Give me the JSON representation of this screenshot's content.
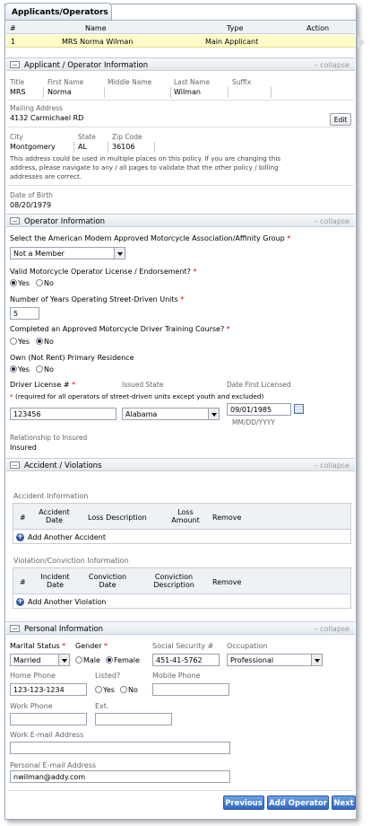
{
  "tab_title": "Applicants/Operators",
  "grid": {
    "headers": [
      "#",
      "Name",
      "Type",
      "Action"
    ],
    "row": {
      "num": "1",
      "name": "MRS Norma Wilman",
      "type": "Main Applicant"
    }
  },
  "collapse_label": "– collapse",
  "applicant": {
    "title": "Applicant / Operator Information",
    "labels": {
      "title": "Title",
      "first": "First Name",
      "middle": "Middle Name",
      "last": "Last Name",
      "suffix": "Suffix",
      "mailing": "Mailing Address",
      "city": "City",
      "state": "State",
      "zip": "Zip Code",
      "dob": "Date of Birth"
    },
    "values": {
      "title": "MRS",
      "first": "Norma",
      "middle": "",
      "last": "Wilman",
      "suffix": "",
      "mailing": "4132 Carmichael RD",
      "city": "Montgomery",
      "state": "AL",
      "zip": "36106",
      "dob": "08/20/1979"
    },
    "edit": "Edit",
    "note": [
      "This address could be used in multiple places on this policy. If you are changing this",
      "address, please navigate to any / all pages to validate that the other policy / billing",
      "addresses are correct."
    ]
  },
  "operator": {
    "title": "Operator Information",
    "assoc_label": "Select the American Modern Approved Motorcycle Association/Affinity Group",
    "assoc_value": "Not a Member",
    "license_q": "Valid Motorcycle Operator License / Endorsement?",
    "years_label": "Number of Years Operating Street-Driven Units",
    "years_value": "5",
    "course_q": "Completed an Approved Motorcycle Driver Training Course?",
    "residence_q": "Own (Not Rent) Primary Residence",
    "yes": "Yes",
    "no": "No",
    "dl_label": "Driver License #",
    "dl_note": "(required for all operators of street-driven units except youth and excluded)",
    "dl_value": "123456",
    "issued_label": "Issued State",
    "issued_value": "Alabama",
    "first_lic_label": "Date First Licensed",
    "first_lic_value": "09/01/1985",
    "date_hint": "MM/DD/YYYY",
    "rel_label": "Relationship to Insured",
    "rel_value": "Insured"
  },
  "accidents": {
    "title": "Accident / Violations",
    "acc_title": "Accident Information",
    "acc_headers": [
      "#",
      "Accident Date",
      "Loss Description",
      "Loss Amount",
      "Remove"
    ],
    "acc_add": "Add Another Accident",
    "vio_title": "Violation/Conviction Information",
    "vio_headers": [
      "#",
      "Incident Date",
      "Conviction Date",
      "Conviction Description",
      "Remove"
    ],
    "vio_add": "Add Another Violation"
  },
  "personal": {
    "title": "Personal Information",
    "marital_label": "Marital Status",
    "marital_value": "Married",
    "gender_label": "Gender",
    "male": "Male",
    "female": "Female",
    "ssn_label": "Social Security #",
    "ssn_value": "451-41-5762",
    "occ_label": "Occupation",
    "occ_value": "Professional",
    "home_label": "Home Phone",
    "home_value": "123-123-1234",
    "listed_label": "Listed?",
    "mobile_label": "Mobile Phone",
    "work_label": "Work Phone",
    "ext_label": "Ext.",
    "work_email_label": "Work E-mail Address",
    "personal_email_label": "Personal E-mail Address",
    "personal_email_value": "nwilman@addy.com"
  },
  "buttons": {
    "previous": "Previous",
    "add_operator": "Add Operator",
    "next": "Next"
  }
}
